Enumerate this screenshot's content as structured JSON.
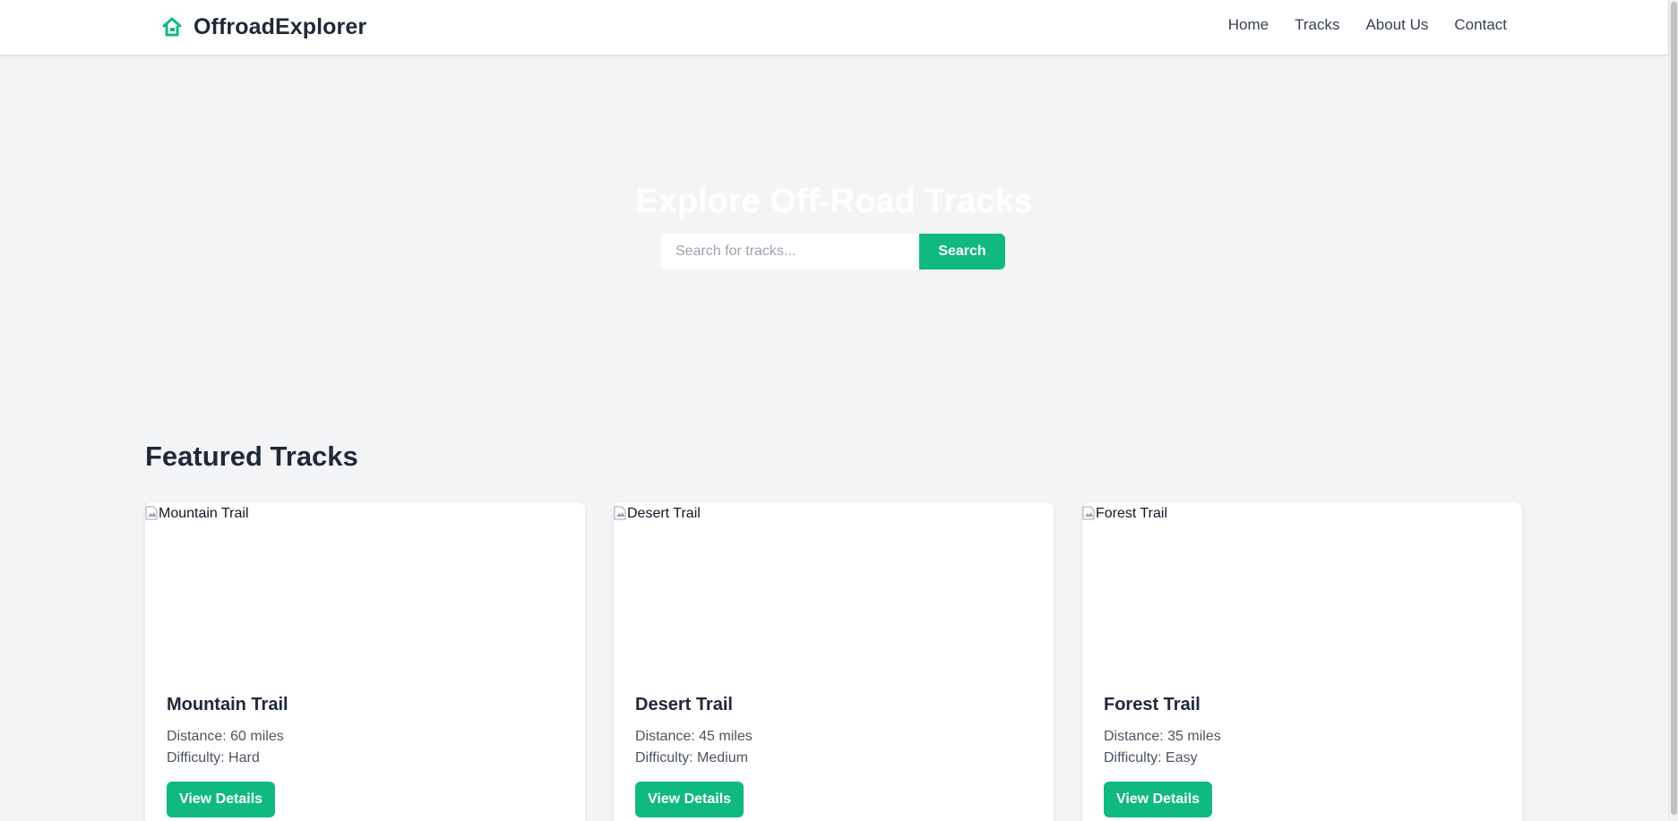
{
  "brand": {
    "name": "OffroadExplorer",
    "icon": "house-icon",
    "accent_color": "#10b981"
  },
  "nav": {
    "items": [
      {
        "label": "Home"
      },
      {
        "label": "Tracks"
      },
      {
        "label": "About Us"
      },
      {
        "label": "Contact"
      }
    ]
  },
  "hero": {
    "title": "Explore Off-Road Tracks",
    "search_placeholder": "Search for tracks...",
    "search_value": "",
    "search_button": "Search"
  },
  "featured": {
    "title": "Featured Tracks",
    "cards": [
      {
        "image_alt": "Mountain Trail",
        "title": "Mountain Trail",
        "distance": "Distance: 60 miles",
        "difficulty": "Difficulty: Hard",
        "button": "View Details"
      },
      {
        "image_alt": "Desert Trail",
        "title": "Desert Trail",
        "distance": "Distance: 45 miles",
        "difficulty": "Difficulty: Medium",
        "button": "View Details"
      },
      {
        "image_alt": "Forest Trail",
        "title": "Forest Trail",
        "distance": "Distance: 35 miles",
        "difficulty": "Difficulty: Easy",
        "button": "View Details"
      }
    ]
  }
}
